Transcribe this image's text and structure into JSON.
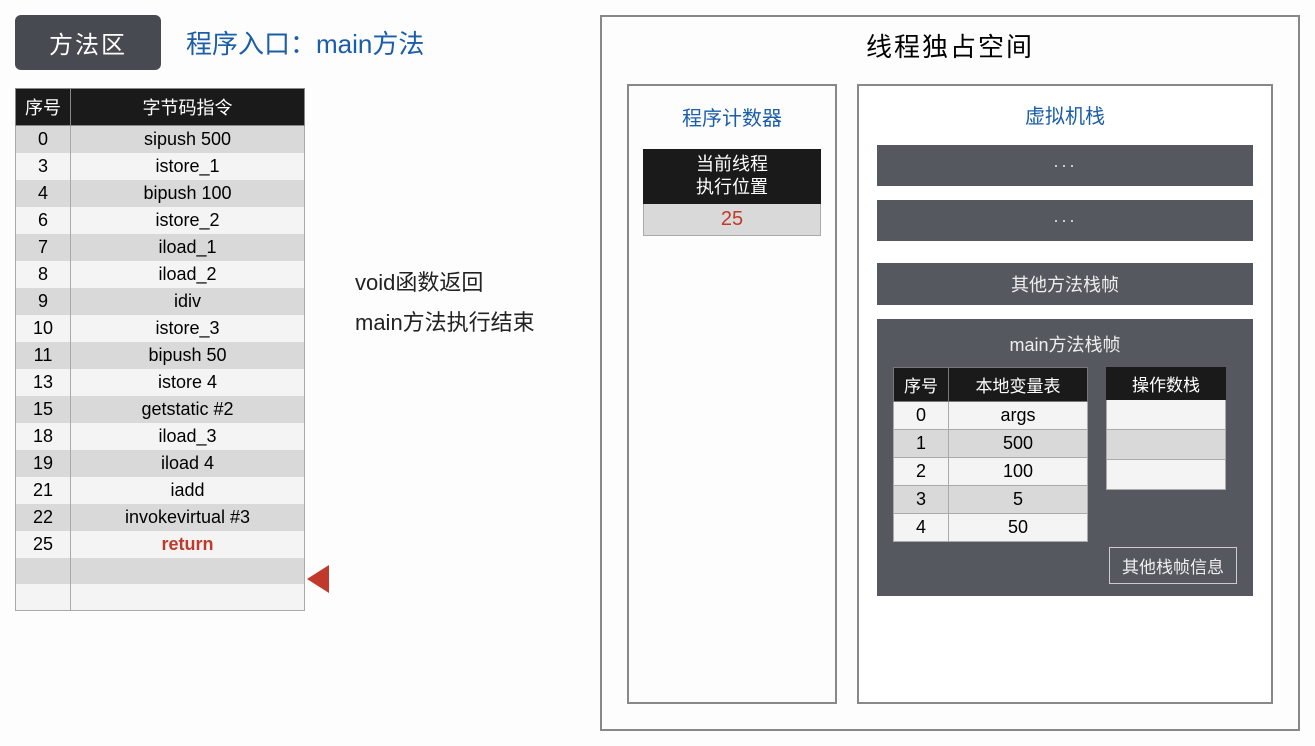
{
  "method_area": {
    "badge": "方法区",
    "entry_label": "程序入口：main方法",
    "table_headers": {
      "seq": "序号",
      "instr": "字节码指令"
    },
    "rows": [
      {
        "seq": "0",
        "instr": "sipush 500"
      },
      {
        "seq": "3",
        "instr": "istore_1"
      },
      {
        "seq": "4",
        "instr": "bipush 100"
      },
      {
        "seq": "6",
        "instr": "istore_2"
      },
      {
        "seq": "7",
        "instr": "iload_1"
      },
      {
        "seq": "8",
        "instr": "iload_2"
      },
      {
        "seq": "9",
        "instr": "idiv"
      },
      {
        "seq": "10",
        "instr": "istore_3"
      },
      {
        "seq": "11",
        "instr": "bipush 50"
      },
      {
        "seq": "13",
        "instr": "istore 4"
      },
      {
        "seq": "15",
        "instr": "getstatic #2"
      },
      {
        "seq": "18",
        "instr": "iload_3"
      },
      {
        "seq": "19",
        "instr": "iload 4"
      },
      {
        "seq": "21",
        "instr": "iadd"
      },
      {
        "seq": "22",
        "instr": "invokevirtual #3"
      },
      {
        "seq": "25",
        "instr": "return",
        "highlight": true
      }
    ],
    "highlight_index": 15,
    "note_line1": "void函数返回",
    "note_line2": "main方法执行结束"
  },
  "thread_area": {
    "title": "线程独占空间",
    "pc": {
      "title": "程序计数器",
      "header_l1": "当前线程",
      "header_l2": "执行位置",
      "value": "25"
    },
    "vm_stack": {
      "title": "虚拟机栈",
      "slot_placeholder": "···",
      "other_frames_label": "其他方法栈帧",
      "frame": {
        "title": "main方法栈帧",
        "lv_headers": {
          "seq": "序号",
          "val": "本地变量表"
        },
        "lv_rows": [
          {
            "seq": "0",
            "val": "args"
          },
          {
            "seq": "1",
            "val": "500"
          },
          {
            "seq": "2",
            "val": "100"
          },
          {
            "seq": "3",
            "val": "5"
          },
          {
            "seq": "4",
            "val": "50"
          }
        ],
        "op_header": "操作数栈",
        "footer": "其他栈帧信息"
      }
    }
  }
}
